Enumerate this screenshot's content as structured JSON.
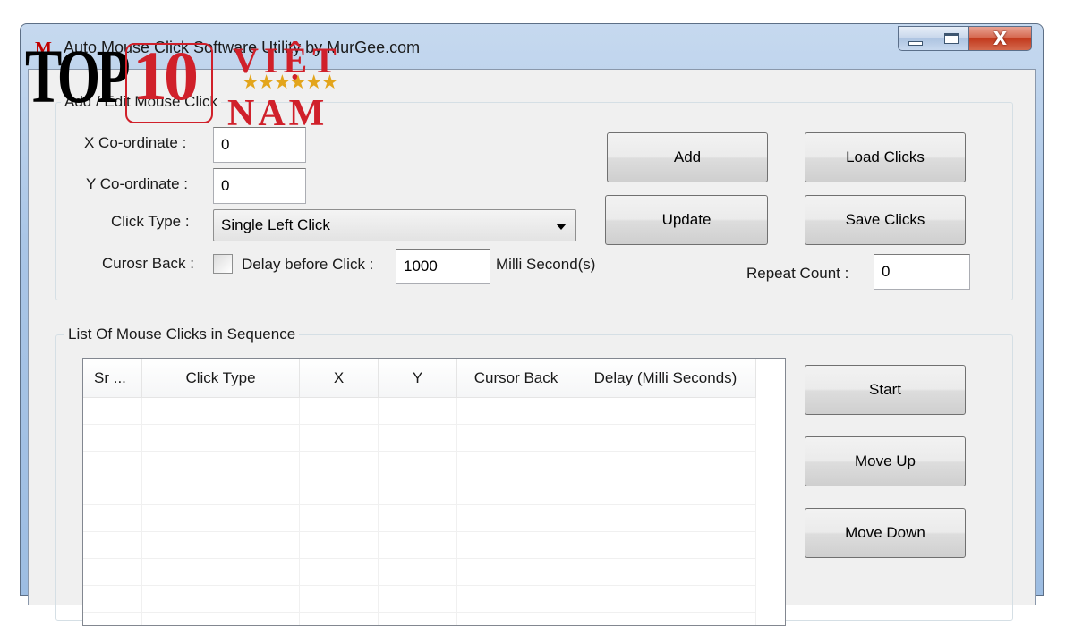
{
  "window": {
    "app_icon": "M",
    "title": "Auto Mouse Click Software Utility by MurGee.com",
    "caption": {
      "min_icon": "minimize-icon",
      "max_icon": "maximize-icon",
      "close_glyph": "X"
    }
  },
  "add_edit": {
    "group_title": "Add / Edit Mouse Click",
    "x_label": "X Co-ordinate :",
    "x_value": "0",
    "y_label": "Y Co-ordinate :",
    "y_value": "0",
    "click_type_label": "Click Type :",
    "click_type_value": "Single Left Click",
    "cursor_back_label": "Curosr Back :",
    "cursor_back_checked": false,
    "delay_label": "Delay before Click :",
    "delay_value": "1000",
    "delay_unit": "Milli Second(s)",
    "repeat_label": "Repeat Count :",
    "repeat_value": "0",
    "add_button": "Add",
    "update_button": "Update",
    "load_button": "Load Clicks",
    "save_button": "Save Clicks"
  },
  "list": {
    "group_title": "List Of Mouse Clicks in Sequence",
    "columns": [
      "Sr ...",
      "Click Type",
      "X",
      "Y",
      "Cursor Back",
      "Delay (Milli Seconds)"
    ],
    "rows": [],
    "start_button": "Start",
    "move_up_button": "Move Up",
    "move_down_button": "Move Down"
  },
  "watermark": {
    "top": "TOP",
    "ten": "10",
    "viet": "VIỆT",
    "stars": "★★★★★★",
    "nam": "NAM"
  },
  "colors": {
    "watermark_red": "#d0202a",
    "star_gold": "#e3a51c",
    "close_red": "#c2391d"
  }
}
